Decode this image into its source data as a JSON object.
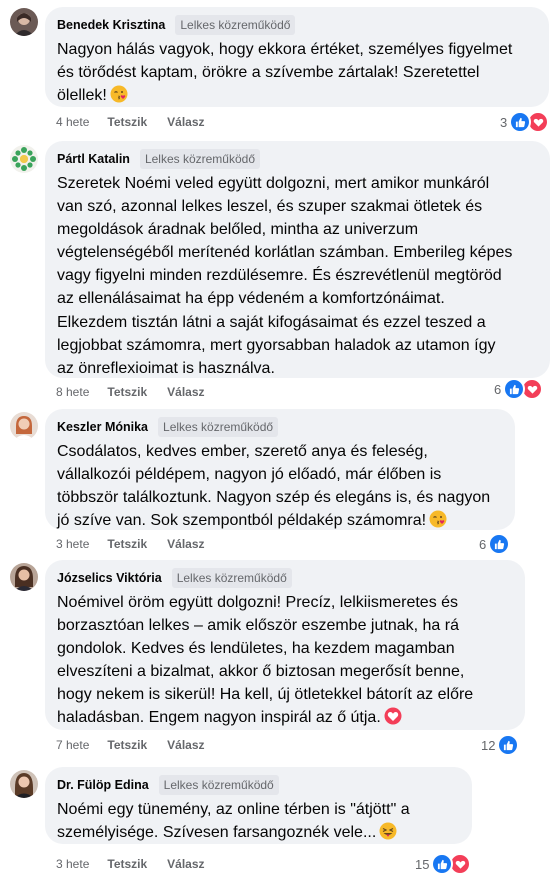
{
  "badge_label": "Lelkes közreműködő",
  "actions": {
    "like_label": "Tetszik",
    "reply_label": "Válasz"
  },
  "colors": {
    "like": "#1877f2",
    "love": "#f33e58",
    "bubble": "#f0f2f5",
    "badge_bg": "#e4e6eb",
    "muted": "#65676b"
  },
  "comments": [
    {
      "author": "Benedek Krisztina",
      "lines": [
        "Nagyon hálás vagyok, hogy ekkora értéket, személyes figyelmet",
        "és törődést kaptam, örökre a szívembe zártalak! Szeretettel",
        "ölellek!"
      ],
      "emoji": "kiss-emoji",
      "time": "4 hete",
      "reaction_count": "3",
      "reactions": [
        "like",
        "love"
      ]
    },
    {
      "author": "Pártl Katalin",
      "lines": [
        "Szeretek Noémi veled együtt dolgozni, mert amikor munkáról",
        "van szó, azonnal lelkes leszel, és szuper szakmai ötletek és",
        "megoldások áradnak belőled, mintha az univerzum",
        "végtelenségéből merítenéd korlátlan számban. Emberileg képes",
        "vagy figyelni minden rezdülésemre. És észrevétlenül megtöröd",
        "az ellenálásaimat ha épp védeném a komfortzónáimat.",
        "Elkezdem tisztán látni a saját kifogásaimat és ezzel teszed a",
        "legjobbat számomra, mert gyorsabban haladok az utamon így",
        "az önreflexioimat is használva."
      ],
      "emoji": "",
      "time": "8 hete",
      "reaction_count": "6",
      "reactions": [
        "like",
        "love"
      ]
    },
    {
      "author": "Keszler Mónika",
      "lines": [
        "Csodálatos, kedves ember, szerető anya és feleség,",
        "vállalkozói példépem, nagyon jó előadó, már élőben is",
        "többször találkoztunk. Nagyon szép és elegáns is, és nagyon",
        "jó szíve van. Sok szempontból példakép számomra!"
      ],
      "emoji": "kiss-emoji",
      "time": "3 hete",
      "reaction_count": "6",
      "reactions": [
        "like"
      ]
    },
    {
      "author": "Józselics Viktória",
      "lines": [
        "Noémivel öröm együtt dolgozni! Precíz, lelkiismeretes és",
        "borzasztóan lelkes – amik először eszembe jutnak, ha rá",
        "gondolok. Kedves és lendületes, ha kezdem magamban",
        "elveszíteni a bizalmat, akkor ő biztosan megerősít benne,",
        "hogy nekem is sikerül! Ha kell, új ötletekkel bátorít az előre",
        "haladásban. Engem nagyon inspirál az ő útja."
      ],
      "emoji": "heart-emoji",
      "time": "7 hete",
      "reaction_count": "12",
      "reactions": [
        "like"
      ]
    },
    {
      "author": "Dr. Fülöp Edina",
      "lines": [
        "Noémi egy tünemény, az online térben is \"átjött\" a",
        "személyisége. Szívesen farsangoznék vele..."
      ],
      "emoji": "tongue-wink-emoji",
      "time": "3 hete",
      "reaction_count": "15",
      "reactions": [
        "like",
        "love"
      ]
    }
  ]
}
